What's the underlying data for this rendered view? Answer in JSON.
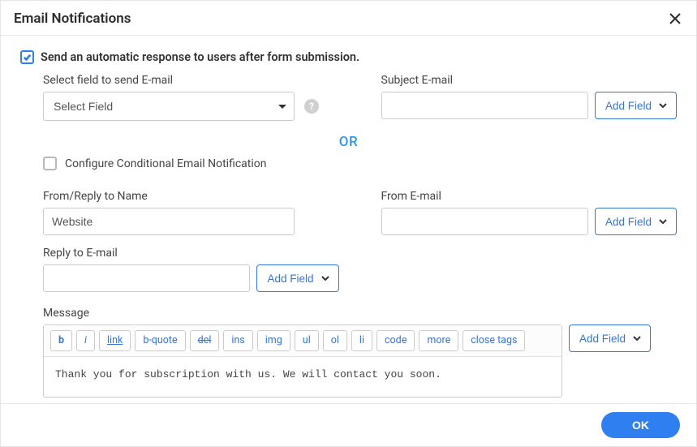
{
  "header": {
    "title": "Email Notifications"
  },
  "auto_response": {
    "checked": true,
    "label": "Send an automatic response to users after form submission."
  },
  "left": {
    "select_field": {
      "label": "Select field to send E-mail",
      "selected": "Select Field"
    },
    "from_reply_name": {
      "label": "From/Reply to Name",
      "value": "Website"
    },
    "reply_email": {
      "label": "Reply to E-mail",
      "add_field_label": "Add Field",
      "value": ""
    }
  },
  "right": {
    "subject": {
      "label": "Subject E-mail",
      "add_field_label": "Add Field",
      "value": ""
    },
    "from_email": {
      "label": "From E-mail",
      "add_field_label": "Add Field",
      "value": ""
    }
  },
  "divider": "OR",
  "conditional": {
    "checked": false,
    "label": "Configure Conditional Email Notification"
  },
  "message": {
    "label": "Message",
    "add_field_label": "Add Field",
    "toolbar": {
      "b": "b",
      "i": "i",
      "link": "link",
      "bquote": "b-quote",
      "del": "del",
      "ins": "ins",
      "img": "img",
      "ul": "ul",
      "ol": "ol",
      "li": "li",
      "code": "code",
      "more": "more",
      "close": "close tags"
    },
    "content": "Thank you for subscription with us. We will contact you soon."
  },
  "footer": {
    "ok": "OK"
  }
}
